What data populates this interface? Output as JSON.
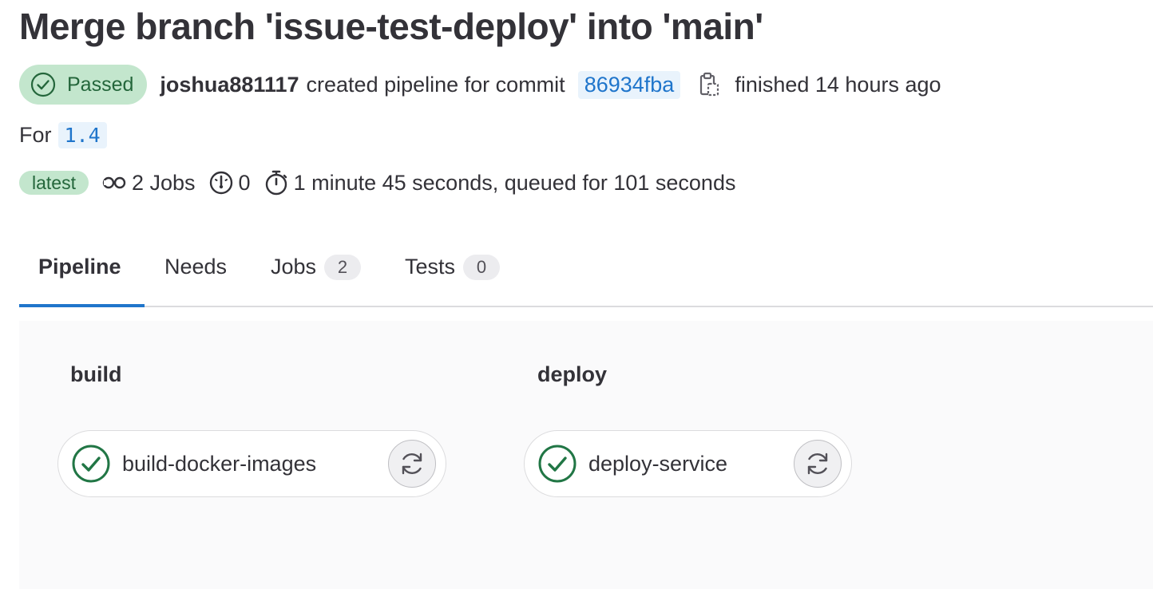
{
  "title": "Merge branch 'issue-test-deploy' into 'main'",
  "status": {
    "label": "Passed",
    "color": "#24663b",
    "background": "#c3e6cd",
    "icon": "status-success-icon"
  },
  "meta": {
    "username": "joshua881117",
    "action_text": "created pipeline for commit",
    "commit_sha": "86934fba",
    "copy_icon": "copy-to-clipboard-icon",
    "finished_text": "finished 14 hours ago"
  },
  "ref": {
    "prefix": "For",
    "name": "1.4"
  },
  "stats": {
    "latest_label": "latest",
    "jobs_text": "2 Jobs",
    "jobs_icon": "pipeline-jobs-icon",
    "dependency_count": "0",
    "dependency_icon": "timer-icon",
    "duration_text": "1 minute 45 seconds, queued for 101 seconds",
    "duration_icon": "stopwatch-icon"
  },
  "tabs": [
    {
      "label": "Pipeline",
      "active": true
    },
    {
      "label": "Needs",
      "active": false
    },
    {
      "label": "Jobs",
      "count": "2",
      "active": false
    },
    {
      "label": "Tests",
      "count": "0",
      "active": false
    }
  ],
  "stages": [
    {
      "name": "build",
      "jobs": [
        {
          "name": "build-docker-images",
          "status": "success",
          "action_icon": "retry-icon"
        }
      ]
    },
    {
      "name": "deploy",
      "jobs": [
        {
          "name": "deploy-service",
          "status": "success",
          "action_icon": "retry-icon"
        }
      ]
    }
  ],
  "colors": {
    "accent": "#1f75cb",
    "success": "#217645",
    "success_bg": "#c3e6cd",
    "text": "#333238"
  }
}
